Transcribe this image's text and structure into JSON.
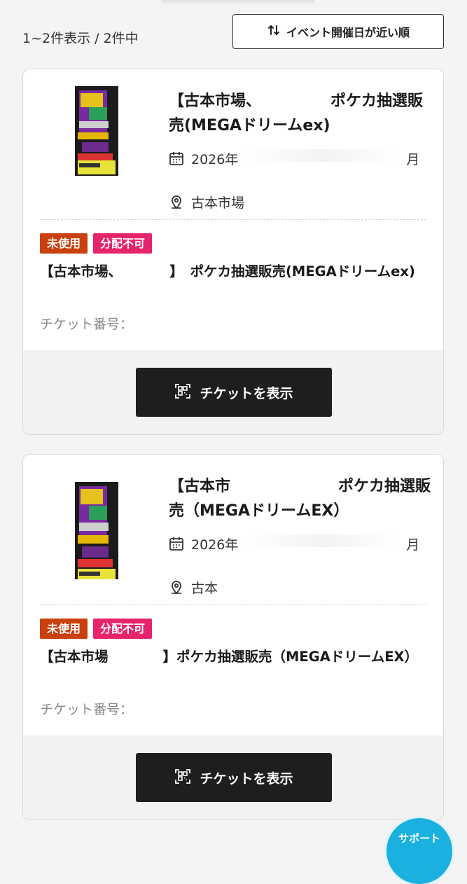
{
  "list": {
    "result_count": "1~2件表示 / 2件中",
    "sort_label": "イベント開催日が近い順"
  },
  "tickets": [
    {
      "event_title": "【古本市場、　　　　　ポケカ抽選販売(MEGAドリームex)",
      "date": "2026年",
      "date_tail": "月",
      "venue": "古本市場",
      "badge_unused": "未使用",
      "badge_nodist": "分配不可",
      "ticket_title": "【古本市場、　　　　】　ポケカ抽選販売(MEGAドリームex)",
      "ticket_number_label": "チケット番号：",
      "show_button": "チケットを表示"
    },
    {
      "event_title": "【古本市　　　　　　　ポケカ抽選販売（MEGAドリームEX）",
      "date": "2026年",
      "date_tail": "月",
      "venue": "古本　　　　　　",
      "badge_unused": "未使用",
      "badge_nodist": "分配不可",
      "ticket_title": "【古本市場　　　　】ポケカ抽選販売（MEGAドリームEX）",
      "ticket_number_label": "チケット番号：",
      "show_button": "チケットを表示"
    }
  ],
  "support": {
    "label": "サポート"
  },
  "colors": {
    "badge_unused": "#c9410e",
    "badge_nodist": "#e5246c",
    "primary_button": "#1e1e1e",
    "support": "#1ab0e0"
  },
  "icons": [
    "sort-arrows-icon",
    "calendar-icon",
    "location-pin-icon",
    "qr-code-icon"
  ]
}
